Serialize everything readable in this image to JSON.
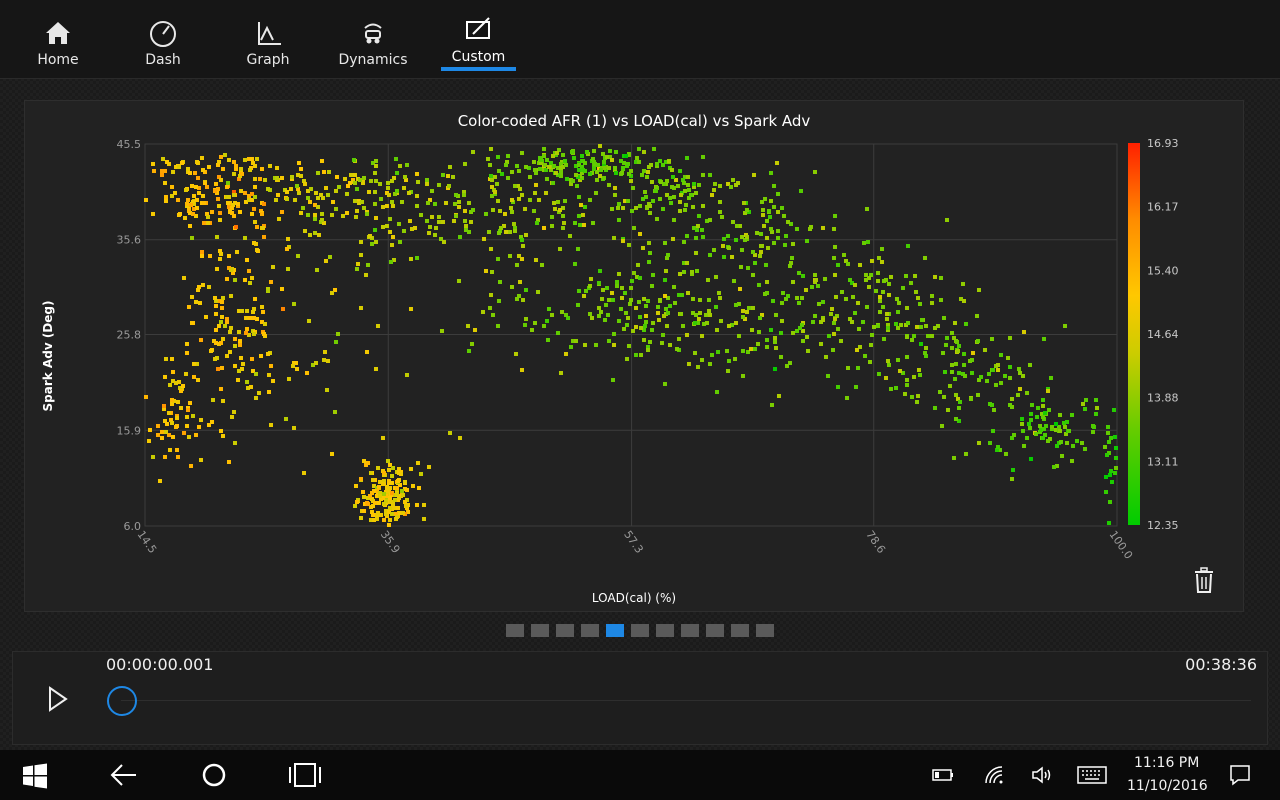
{
  "nav": {
    "items": [
      {
        "label": "Home",
        "icon": "home-icon"
      },
      {
        "label": "Dash",
        "icon": "gauge-icon"
      },
      {
        "label": "Graph",
        "icon": "graph-icon"
      },
      {
        "label": "Dynamics",
        "icon": "dynamics-icon"
      },
      {
        "label": "Custom",
        "icon": "custom-icon"
      }
    ],
    "active": "Custom",
    "accent": "#1e88e5"
  },
  "chart_data": {
    "type": "scatter",
    "title": "Color-coded AFR (1) vs LOAD(cal) vs Spark Adv",
    "xlabel": "LOAD(cal) (%)",
    "ylabel": "Spark Adv (Deg)",
    "xlim": [
      14.5,
      100.0
    ],
    "ylim": [
      6.0,
      45.5
    ],
    "x_ticks": [
      "14.5",
      "35.9",
      "57.3",
      "78.6",
      "100.0"
    ],
    "y_ticks": [
      "45.5",
      "35.6",
      "25.8",
      "15.9",
      "6.0"
    ],
    "colorbar": {
      "label_values": [
        "16.93",
        "16.17",
        "15.40",
        "14.64",
        "13.88",
        "13.11",
        "12.35"
      ],
      "range": [
        12.35,
        16.93
      ],
      "colors": [
        "#00cc00",
        "#66cc00",
        "#cccc00",
        "#ffc800",
        "#ff8c00",
        "#ff2000"
      ]
    },
    "grid": true,
    "clusters": [
      {
        "x": 20.5,
        "y": 40.0,
        "sx": 2.8,
        "sy": 1.6,
        "afr": 15.3,
        "count": 110
      },
      {
        "x": 19.5,
        "y": 43.3,
        "sx": 3.5,
        "sy": 0.7,
        "afr": 15.0,
        "count": 40
      },
      {
        "x": 27.5,
        "y": 41.0,
        "sx": 5.0,
        "sy": 1.8,
        "afr": 14.6,
        "count": 80
      },
      {
        "x": 33.0,
        "y": 38.5,
        "sx": 4.5,
        "sy": 3.0,
        "afr": 14.4,
        "count": 60
      },
      {
        "x": 22.5,
        "y": 26.0,
        "sx": 2.5,
        "sy": 6.0,
        "afr": 15.0,
        "count": 150
      },
      {
        "x": 16.5,
        "y": 17.5,
        "sx": 1.6,
        "sy": 2.5,
        "afr": 15.1,
        "count": 60
      },
      {
        "x": 35.8,
        "y": 9.3,
        "sx": 1.3,
        "sy": 1.6,
        "afr": 14.9,
        "count": 170
      },
      {
        "x": 45.0,
        "y": 39.5,
        "sx": 7.0,
        "sy": 3.0,
        "afr": 14.0,
        "count": 180
      },
      {
        "x": 53.0,
        "y": 43.3,
        "sx": 4.5,
        "sy": 0.8,
        "afr": 13.4,
        "count": 130
      },
      {
        "x": 60.0,
        "y": 41.0,
        "sx": 4.5,
        "sy": 1.5,
        "afr": 13.6,
        "count": 90
      },
      {
        "x": 67.0,
        "y": 36.0,
        "sx": 4.5,
        "sy": 2.5,
        "afr": 13.7,
        "count": 110
      },
      {
        "x": 56.0,
        "y": 28.5,
        "sx": 6.0,
        "sy": 2.5,
        "afr": 13.7,
        "count": 130
      },
      {
        "x": 66.0,
        "y": 26.5,
        "sx": 5.5,
        "sy": 3.0,
        "afr": 13.8,
        "count": 100
      },
      {
        "x": 78.0,
        "y": 29.5,
        "sx": 4.0,
        "sy": 2.5,
        "afr": 13.8,
        "count": 120
      },
      {
        "x": 86.0,
        "y": 22.5,
        "sx": 4.0,
        "sy": 2.5,
        "afr": 13.7,
        "count": 110
      },
      {
        "x": 93.5,
        "y": 16.0,
        "sx": 3.5,
        "sy": 2.2,
        "afr": 13.3,
        "count": 100
      },
      {
        "x": 99.5,
        "y": 11.5,
        "sx": 0.5,
        "sy": 2.5,
        "afr": 12.8,
        "count": 20
      },
      {
        "x": 30.0,
        "y": 23.0,
        "sx": 5.0,
        "sy": 8.0,
        "afr": 14.6,
        "count": 40
      },
      {
        "x": 50.0,
        "y": 33.0,
        "sx": 12.0,
        "sy": 6.0,
        "afr": 14.0,
        "count": 60
      }
    ]
  },
  "pager": {
    "count": 11,
    "active_index": 4
  },
  "player": {
    "time_start": "00:00:00.001",
    "time_end": "00:38:36",
    "progress": 0.0
  },
  "taskbar": {
    "time": "11:16 PM",
    "date": "11/10/2016"
  }
}
